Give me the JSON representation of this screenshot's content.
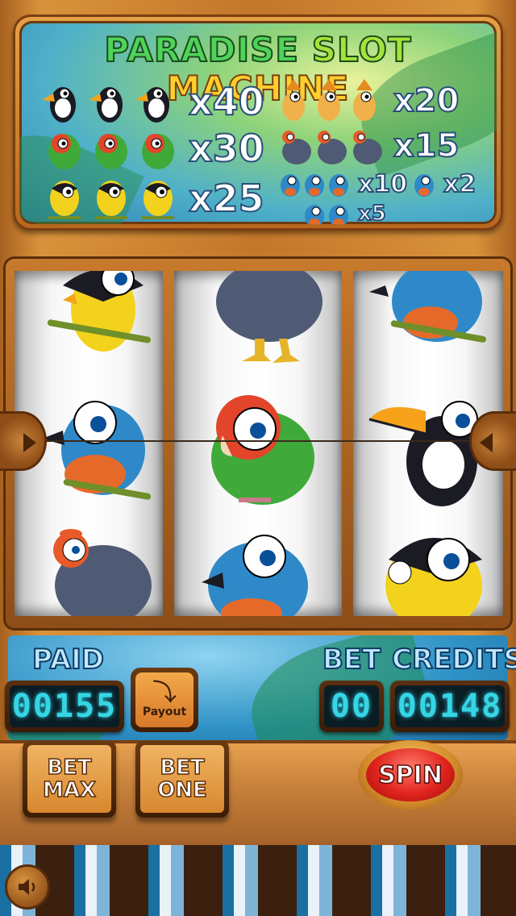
{
  "title": {
    "word1": "PARADISE",
    "word2": "SLOT",
    "word3": "MACHINE"
  },
  "paytable": {
    "left": [
      {
        "bird": "toucan",
        "multiplier": "x40"
      },
      {
        "bird": "lovebird",
        "multiplier": "x30"
      },
      {
        "bird": "yellow-bird",
        "multiplier": "x25"
      }
    ],
    "right": [
      {
        "bird": "hoopoe",
        "multiplier": "x20"
      },
      {
        "bird": "guinea-fowl",
        "multiplier": "x15"
      },
      {
        "bird": "blue-bird",
        "multiplier": "x10"
      },
      {
        "bird": "blue-bird-pair",
        "multiplier": "x2"
      },
      {
        "bird": "blue-bird-double",
        "multiplier": "x5"
      }
    ]
  },
  "panel": {
    "paid_label": "PAID",
    "paid_value": "00155",
    "bet_label": "BET",
    "bet_value": "00",
    "credits_label": "CREDITS",
    "credits_value": "00148",
    "payout_label": "Payout"
  },
  "buttons": {
    "bet_max_line1": "BET",
    "bet_max_line2": "MAX",
    "bet_one_line1": "BET",
    "bet_one_line2": "ONE",
    "spin": "SPIN"
  },
  "colors": {
    "digits": "#35d6e4",
    "spin": "#e0241d",
    "wood": "#c8823c"
  }
}
